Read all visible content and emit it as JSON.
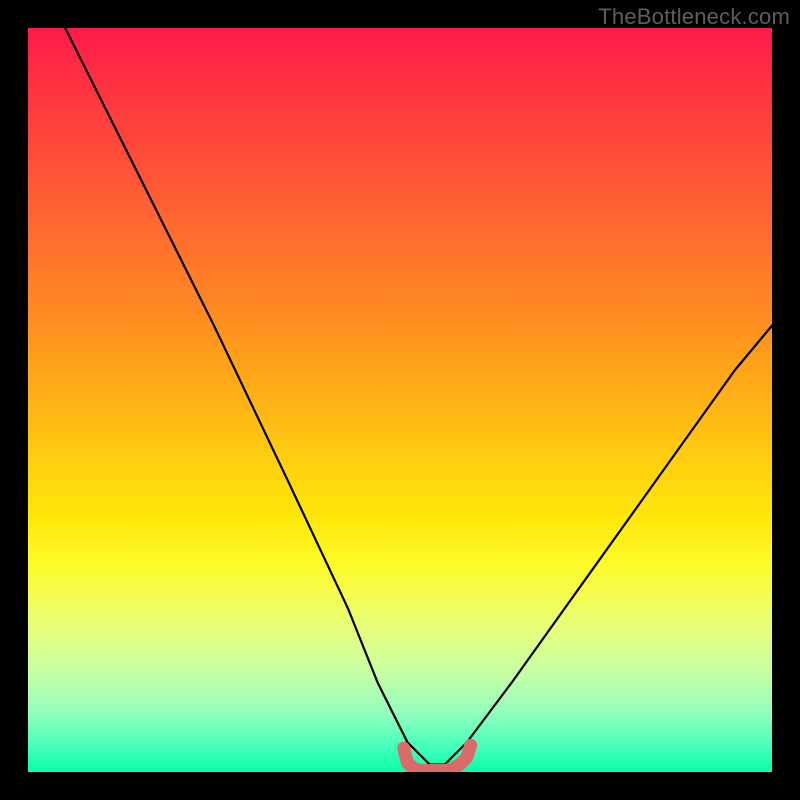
{
  "watermark": "TheBottleneck.com",
  "chart_data": {
    "type": "line",
    "title": "",
    "xlabel": "",
    "ylabel": "",
    "xlim": [
      0,
      100
    ],
    "ylim": [
      0,
      100
    ],
    "grid": false,
    "legend": false,
    "annotations": [],
    "series": [
      {
        "name": "main-curve",
        "color": "#000000",
        "x": [
          5,
          15,
          25,
          35,
          43,
          47,
          51,
          54,
          56,
          59,
          65,
          75,
          85,
          95,
          100
        ],
        "values": [
          100,
          80,
          60,
          39,
          22,
          12,
          4,
          1,
          1,
          4,
          12,
          26,
          40,
          54,
          60
        ]
      },
      {
        "name": "baseline-marker",
        "color": "#d96b68",
        "x": [
          50.5,
          51,
          52,
          53,
          54,
          55,
          56,
          57,
          58,
          59,
          59.5
        ],
        "values": [
          3.2,
          1.2,
          0.4,
          0.2,
          0.2,
          0.2,
          0.2,
          0.4,
          1.0,
          2.0,
          3.6
        ]
      }
    ]
  }
}
